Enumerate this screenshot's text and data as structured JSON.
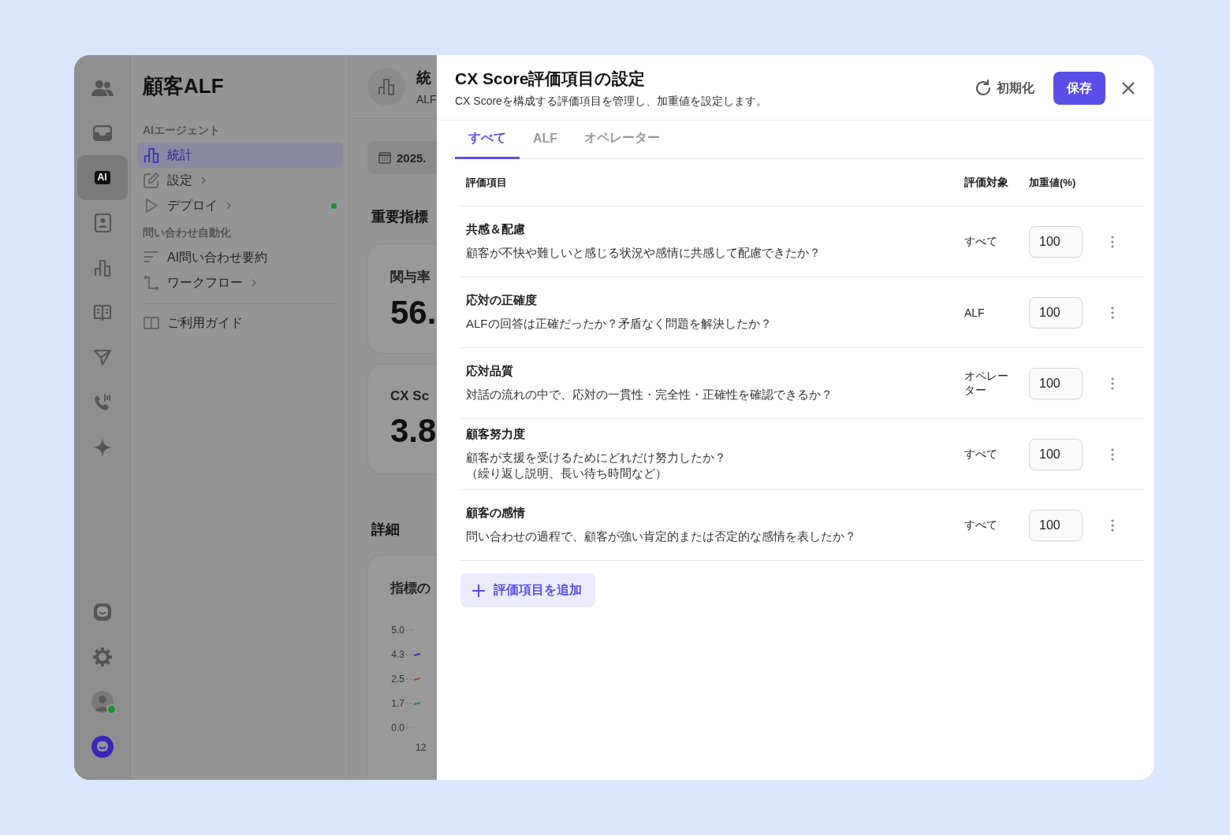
{
  "rail": {
    "top": [
      {
        "selected": false
      },
      {
        "selected": false
      },
      {
        "selected": true,
        "label": "AI"
      },
      {
        "selected": false
      },
      {
        "selected": false
      },
      {
        "selected": false
      },
      {
        "selected": false
      },
      {
        "selected": false
      },
      {
        "selected": false
      }
    ],
    "avatar": {
      "online": true
    }
  },
  "sidebar": {
    "title": "顧客ALF",
    "sections": [
      {
        "heading": "AIエージェント",
        "items": [
          {
            "label": "統計",
            "selected": true,
            "chevron": false,
            "live": false
          },
          {
            "label": "設定",
            "selected": false,
            "chevron": true,
            "live": false
          },
          {
            "label": "デプロイ",
            "selected": false,
            "chevron": true,
            "live": true
          }
        ]
      },
      {
        "heading": "問い合わせ自動化",
        "items": [
          {
            "label": "AI問い合わせ要約",
            "selected": false,
            "chevron": false,
            "live": false
          },
          {
            "label": "ワークフロー",
            "selected": false,
            "chevron": true,
            "live": false
          }
        ]
      }
    ],
    "footer_item": {
      "label": "ご利用ガイド"
    }
  },
  "main": {
    "title": "統",
    "subtitle": "ALF",
    "date": "2025.",
    "key_metrics_heading": "重要指標",
    "cards": [
      {
        "label": "関与率",
        "value": "56."
      },
      {
        "label": "CX Sc",
        "value": "3.8"
      }
    ],
    "details_heading": "詳細",
    "trend_card": {
      "title": "指標の",
      "y_ticks": [
        "5.0",
        "4.3",
        "2.5",
        "1.7",
        "0.0"
      ],
      "x_tick": "12"
    }
  },
  "panel": {
    "title": "CX Score評価項目の設定",
    "subtitle": "CX Scoreを構成する評価項目を管理し、加重値を設定します。",
    "reset_label": "初期化",
    "save_label": "保存",
    "tabs": [
      {
        "label": "すべて",
        "selected": true
      },
      {
        "label": "ALF",
        "selected": false
      },
      {
        "label": "オペレーター",
        "selected": false
      }
    ],
    "columns": [
      "評価項目",
      "評価対象",
      "加重値(%)"
    ],
    "rows": [
      {
        "title": "共感＆配慮",
        "description": "顧客が不快や難しいと感じる状況や感情に共感して配慮できたか？",
        "target": "すべて",
        "weight": "100"
      },
      {
        "title": "応対の正確度",
        "description": "ALFの回答は正確だったか？矛盾なく問題を解決したか？",
        "target": "ALF",
        "weight": "100"
      },
      {
        "title": "応対品質",
        "description": "対話の流れの中で、応対の一貫性・完全性・正確性を確認できるか？",
        "target": "オペレーター",
        "weight": "100"
      },
      {
        "title": "顧客努力度",
        "description": "顧客が支援を受けるためにどれだけ努力したか？",
        "description_note": "（繰り返し説明、長い待ち時間など）",
        "target": "すべて",
        "weight": "100"
      },
      {
        "title": "顧客の感情",
        "description": "問い合わせの過程で、顧客が強い肯定的または否定的な感情を表したか？",
        "target": "すべて",
        "weight": "100"
      }
    ],
    "add_label": "評価項目を追加"
  }
}
